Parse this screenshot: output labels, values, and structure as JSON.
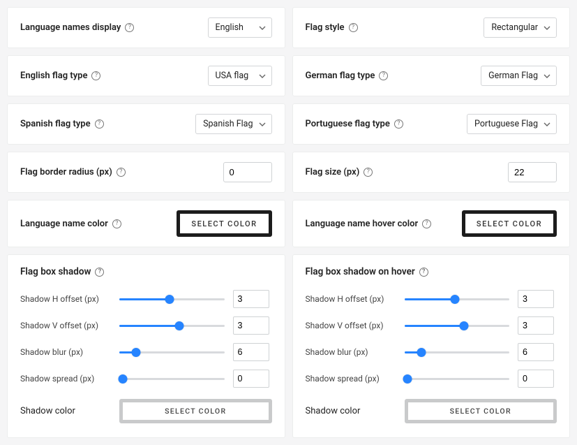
{
  "buttons": {
    "select_color": "SELECT COLOR"
  },
  "left": {
    "lang_display": {
      "label": "Language names display",
      "value": "English"
    },
    "eng_flag": {
      "label": "English flag type",
      "value": "USA flag"
    },
    "es_flag": {
      "label": "Spanish flag type",
      "value": "Spanish Flag"
    },
    "border_radius": {
      "label": "Flag border radius (px)",
      "value": "0"
    },
    "name_color": {
      "label": "Language name color"
    },
    "shadow": {
      "title": "Flag box shadow",
      "h": {
        "label": "Shadow H offset (px)",
        "value": "3",
        "pct": 48
      },
      "v": {
        "label": "Shadow V offset (px)",
        "value": "3",
        "pct": 57
      },
      "blur": {
        "label": "Shadow blur (px)",
        "value": "6",
        "pct": 16
      },
      "spread": {
        "label": "Shadow spread (px)",
        "value": "0",
        "pct": 3
      },
      "color": {
        "label": "Shadow color"
      }
    }
  },
  "right": {
    "flag_style": {
      "label": "Flag style",
      "value": "Rectangular"
    },
    "de_flag": {
      "label": "German flag type",
      "value": "German Flag"
    },
    "pt_flag": {
      "label": "Portuguese flag type",
      "value": "Portuguese Flag"
    },
    "flag_size": {
      "label": "Flag size (px)",
      "value": "22"
    },
    "hover_color": {
      "label": "Language name hover color"
    },
    "shadow": {
      "title": "Flag box shadow on hover",
      "h": {
        "label": "Shadow H offset (px)",
        "value": "3",
        "pct": 48
      },
      "v": {
        "label": "Shadow V offset (px)",
        "value": "3",
        "pct": 57
      },
      "blur": {
        "label": "Shadow blur (px)",
        "value": "6",
        "pct": 16
      },
      "spread": {
        "label": "Shadow spread (px)",
        "value": "0",
        "pct": 3
      },
      "color": {
        "label": "Shadow color"
      }
    }
  }
}
